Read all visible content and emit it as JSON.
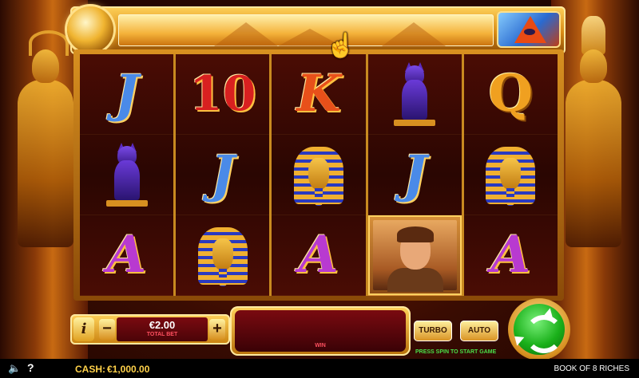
{
  "game": {
    "title": "BOOK OF 8 RICHES"
  },
  "reels": [
    [
      "J",
      "bastet-cat",
      "A"
    ],
    [
      "10",
      "J",
      "pharaoh-mask"
    ],
    [
      "K",
      "pharaoh-mask",
      "A"
    ],
    [
      "bastet-cat",
      "J",
      "explorer"
    ],
    [
      "Q",
      "pharaoh-mask",
      "A"
    ]
  ],
  "highlighted_cell": {
    "reel": 4,
    "row": 3,
    "symbol": "explorer"
  },
  "bet": {
    "value": "€2.00",
    "label": "TOTAL BET",
    "minus": "−",
    "plus": "+"
  },
  "info_button": "i",
  "win": {
    "label": "WIN"
  },
  "controls": {
    "turbo": "TURBO",
    "auto": "AUTO",
    "hint": "PRESS SPIN TO START GAME"
  },
  "footer": {
    "cash_label": "CASH:",
    "cash_value": "€1,000.00",
    "help": "?"
  },
  "icons": [
    "sound-icon",
    "help-icon",
    "spin-icon",
    "menu-pyramid-icon",
    "coin-icon",
    "hand-cursor-icon"
  ]
}
